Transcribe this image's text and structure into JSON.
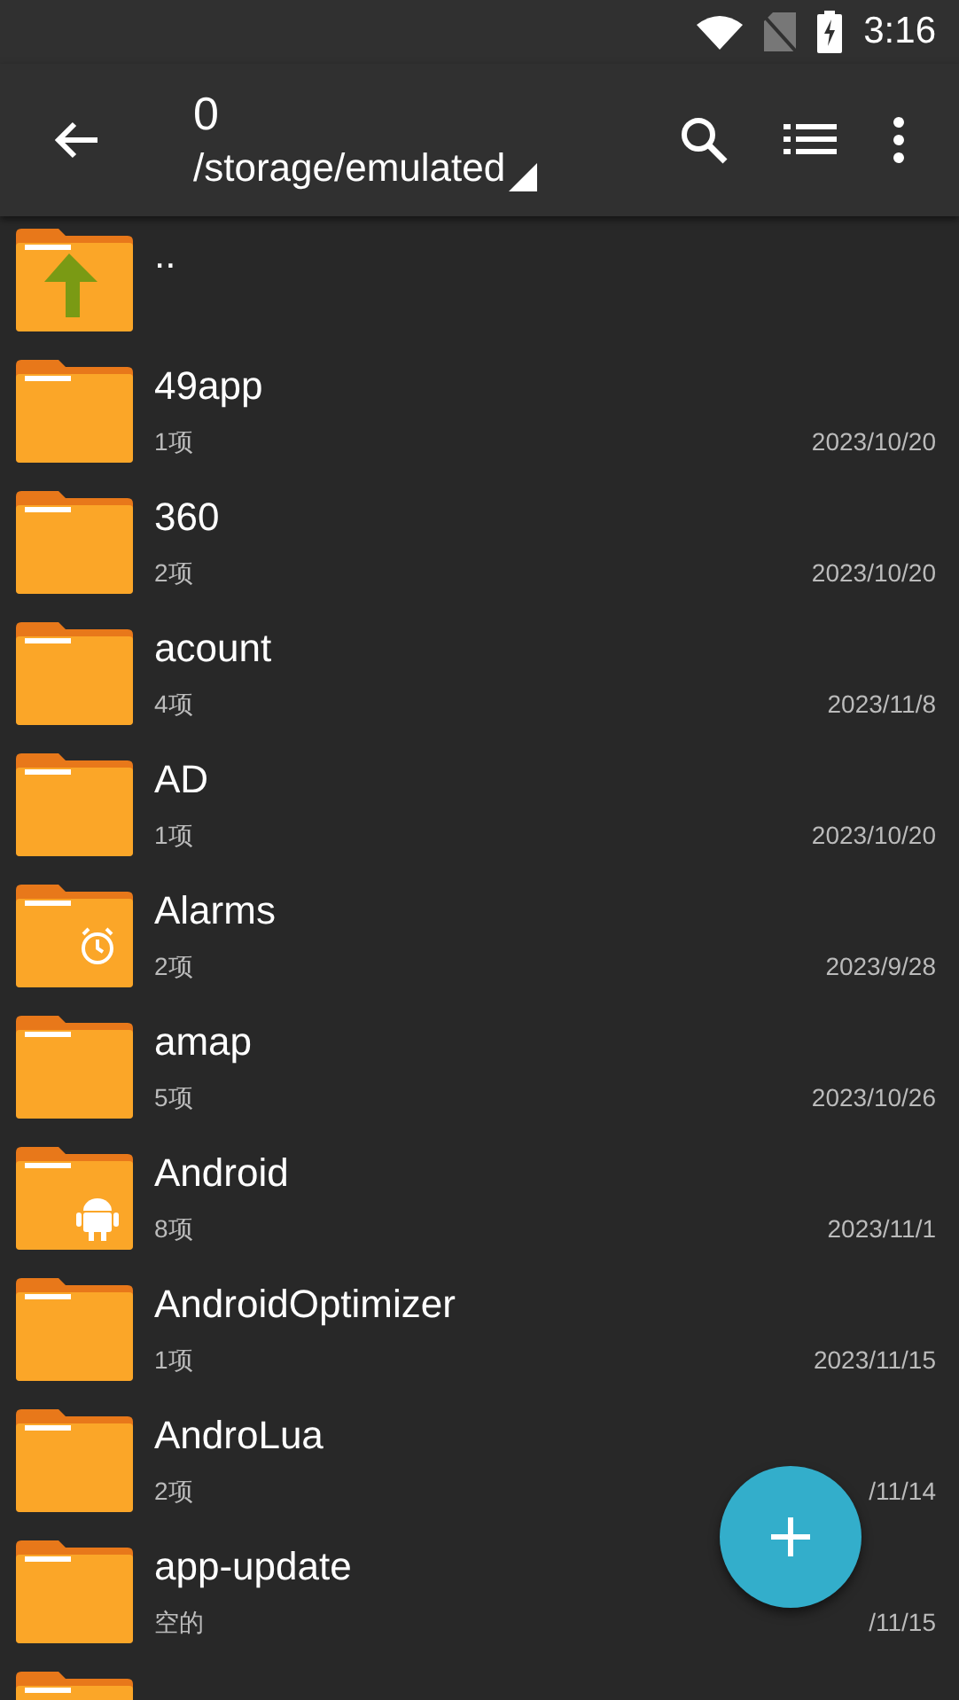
{
  "status_bar": {
    "time": "3:16"
  },
  "toolbar": {
    "title": "0",
    "path": "/storage/emulated"
  },
  "files": [
    {
      "kind": "up",
      "name": ".."
    },
    {
      "kind": "plain",
      "name": "49app",
      "info": "1项",
      "date": "2023/10/20"
    },
    {
      "kind": "plain",
      "name": "360",
      "info": "2项",
      "date": "2023/10/20"
    },
    {
      "kind": "plain",
      "name": "acount",
      "info": "4项",
      "date": "2023/11/8"
    },
    {
      "kind": "plain",
      "name": "AD",
      "info": "1项",
      "date": "2023/10/20"
    },
    {
      "kind": "alarm",
      "name": "Alarms",
      "info": "2项",
      "date": "2023/9/28"
    },
    {
      "kind": "plain",
      "name": "amap",
      "info": "5项",
      "date": "2023/10/26"
    },
    {
      "kind": "android",
      "name": "Android",
      "info": "8项",
      "date": "2023/11/1"
    },
    {
      "kind": "plain",
      "name": "AndroidOptimizer",
      "info": "1项",
      "date": "2023/11/15"
    },
    {
      "kind": "plain",
      "name": "AndroLua",
      "info": "2项",
      "date": "/11/14"
    },
    {
      "kind": "plain",
      "name": "app-update",
      "info": "空的",
      "date": "/11/15"
    },
    {
      "kind": "plain"
    }
  ]
}
